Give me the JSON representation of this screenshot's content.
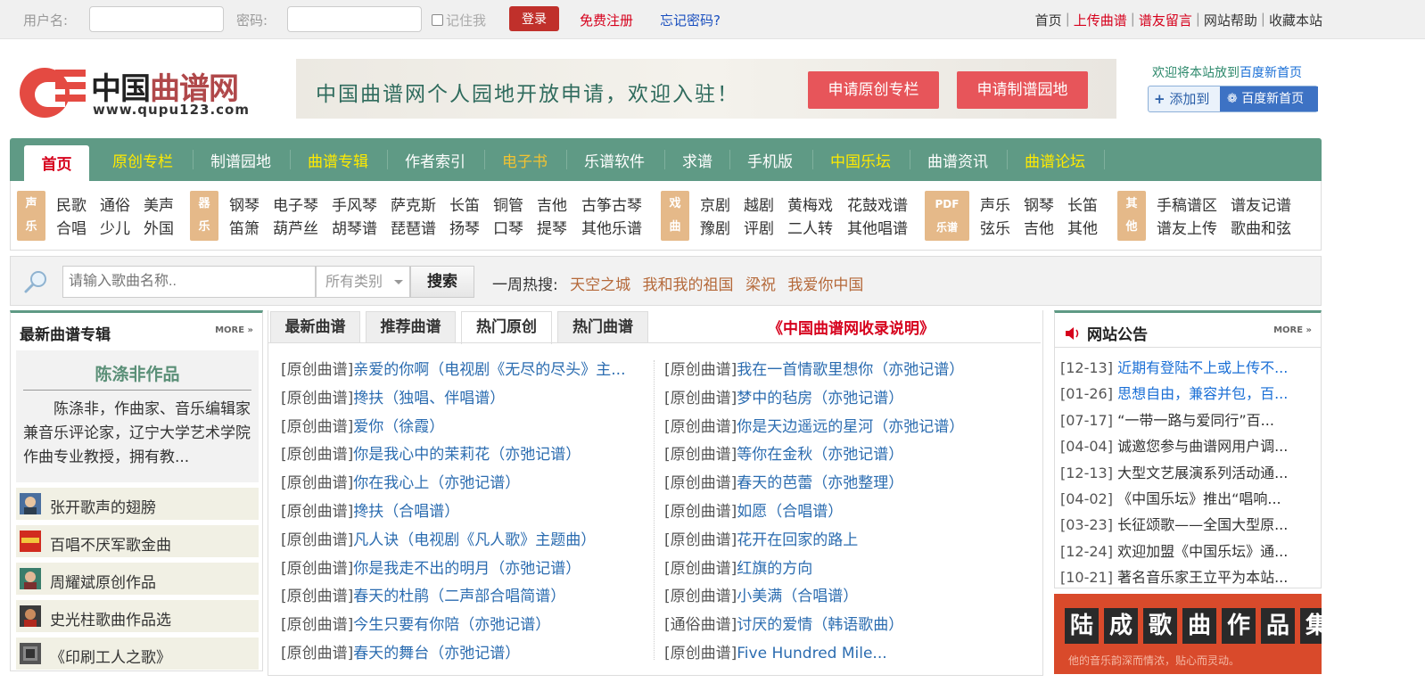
{
  "topbar": {
    "username_label": "用户名:",
    "password_label": "密码:",
    "remember_label": "记住我",
    "login_label": "登录",
    "register_label": "免费注册",
    "forgot_label": "忘记密码?",
    "links": [
      "首页",
      "上传曲谱",
      "谱友留言",
      "网站帮助",
      "收藏本站"
    ]
  },
  "logo": {
    "cn_black": "中国",
    "cn_red": "曲谱网",
    "domain": "www.qupu123.com"
  },
  "banner": {
    "text": "中国曲谱网个人园地开放申请，欢迎入驻！",
    "btn1": "申请原创专栏",
    "btn2": "申请制谱园地"
  },
  "welcome": {
    "text": "欢迎将本站放到",
    "highlight": "百度新首页",
    "add_label": "添加到",
    "baidu_label": "百度新首页"
  },
  "nav": {
    "home": "首页",
    "items": [
      "原创专栏",
      "制谱园地",
      "曲谱专辑",
      "作者索引",
      "电子书",
      "乐谱软件",
      "求谱",
      "手机版",
      "中国乐坛",
      "曲谱资讯",
      "曲谱论坛"
    ],
    "colors": {
      "white": "#ffffff",
      "yellow": "#ffea00",
      "bar": "#5f9a85"
    }
  },
  "categories": {
    "vocal_badge": [
      "声",
      "乐"
    ],
    "vocal_row1": [
      "民歌",
      "通俗",
      "美声"
    ],
    "vocal_row2": [
      "合唱",
      "少儿",
      "外国"
    ],
    "instr_badge": [
      "器",
      "乐"
    ],
    "instr_row1": [
      "钢琴",
      "电子琴",
      "手风琴",
      "萨克斯",
      "长笛",
      "铜管",
      "吉他",
      "古筝古琴"
    ],
    "instr_row2": [
      "笛箫",
      "葫芦丝",
      "胡琴谱",
      "琵琶谱",
      "扬琴",
      "口琴",
      "提琴",
      "其他乐谱"
    ],
    "opera_badge": [
      "戏",
      "曲"
    ],
    "opera_row1": [
      "京剧",
      "越剧",
      "黄梅戏",
      "花鼓戏谱"
    ],
    "opera_row2": [
      "豫剧",
      "评剧",
      "二人转",
      "其他唱谱"
    ],
    "pdf_badge": [
      "PDF",
      "乐谱"
    ],
    "pdf_row1": [
      "声乐",
      "钢琴",
      "长笛"
    ],
    "pdf_row2": [
      "弦乐",
      "吉他",
      "其他"
    ],
    "other_badge": [
      "其",
      "他"
    ],
    "other_row1": [
      "手稿谱区",
      "谱友记谱"
    ],
    "other_row2": [
      "谱友上传",
      "歌曲和弦"
    ]
  },
  "search": {
    "placeholder": "请输入歌曲名称..",
    "category_selected": "所有类别",
    "button": "搜索",
    "hot_label": "一周热搜:",
    "hot_items": [
      "天空之城",
      "我和我的祖国",
      "梁祝",
      "我爱你中国"
    ]
  },
  "left": {
    "title": "最新曲谱专辑",
    "more": "MORE »",
    "featured_title": "陈涤非作品",
    "featured_desc": "陈涤非，作曲家、音乐编辑家兼音乐评论家，辽宁大学艺术学院作曲专业教授，拥有教...",
    "albums": [
      "张开歌声的翅膀",
      "百唱不厌军歌金曲",
      "周耀斌原创作品",
      "史光柱歌曲作品选",
      "《印刷工人之歌》"
    ]
  },
  "middle": {
    "tabs": [
      "最新曲谱",
      "推荐曲谱",
      "热门原创",
      "热门曲谱"
    ],
    "active_tab": "热门原创",
    "notice": "《中国曲谱网收录说明》",
    "col1": [
      {
        "cat": "[原创曲谱]",
        "name": "亲爱的你啊（电视剧《无尽的尽头》主..."
      },
      {
        "cat": "[原创曲谱]",
        "name": "搀扶（独唱、伴唱谱）"
      },
      {
        "cat": "[原创曲谱]",
        "name": "爱你（徐霞）"
      },
      {
        "cat": "[原创曲谱]",
        "name": "你是我心中的茉莉花（亦弛记谱）"
      },
      {
        "cat": "[原创曲谱]",
        "name": "你在我心上（亦弛记谱）"
      },
      {
        "cat": "[原创曲谱]",
        "name": "搀扶（合唱谱）"
      },
      {
        "cat": "[原创曲谱]",
        "name": "凡人诀（电视剧《凡人歌》主题曲）"
      },
      {
        "cat": "[原创曲谱]",
        "name": "你是我走不出的明月（亦弛记谱）"
      },
      {
        "cat": "[原创曲谱]",
        "name": "春天的杜鹃（二声部合唱简谱）"
      },
      {
        "cat": "[原创曲谱]",
        "name": "今生只要有你陪（亦弛记谱）"
      },
      {
        "cat": "[原创曲谱]",
        "name": "春天的舞台（亦弛记谱）"
      }
    ],
    "col2": [
      {
        "cat": "[原创曲谱]",
        "name": "我在一首情歌里想你（亦弛记谱）"
      },
      {
        "cat": "[原创曲谱]",
        "name": "梦中的毡房（亦弛记谱）"
      },
      {
        "cat": "[原创曲谱]",
        "name": "你是天边遥远的星河（亦弛记谱）"
      },
      {
        "cat": "[原创曲谱]",
        "name": "等你在金秋（亦弛记谱）"
      },
      {
        "cat": "[原创曲谱]",
        "name": "春天的芭蕾（亦弛整理）"
      },
      {
        "cat": "[原创曲谱]",
        "name": "如愿（合唱谱）"
      },
      {
        "cat": "[原创曲谱]",
        "name": "花开在回家的路上"
      },
      {
        "cat": "[原创曲谱]",
        "name": "红旗的方向"
      },
      {
        "cat": "[原创曲谱]",
        "name": "小美满（合唱谱）"
      },
      {
        "cat": "[通俗曲谱]",
        "name": "讨厌的爱情（韩语歌曲）"
      },
      {
        "cat": "[原创曲谱]",
        "name": "Five Hundred Mile..."
      }
    ]
  },
  "right": {
    "title": "网站公告",
    "more": "MORE »",
    "news": [
      {
        "date": "[12-13]",
        "title": "近期有登陆不上或上传不...",
        "highlight": true
      },
      {
        "date": "[01-26]",
        "title": "思想自由，兼容并包，百...",
        "highlight": true
      },
      {
        "date": "[07-17]",
        "title": "“一带一路与爱同行”百...",
        "highlight": false
      },
      {
        "date": "[04-04]",
        "title": "诚邀您参与曲谱网用户调...",
        "highlight": false
      },
      {
        "date": "[12-13]",
        "title": "大型文艺展演系列活动通...",
        "highlight": false
      },
      {
        "date": "[04-02]",
        "title": "《中国乐坛》推出“唱响...",
        "highlight": false
      },
      {
        "date": "[03-23]",
        "title": "长征颂歌——全国大型原...",
        "highlight": false
      },
      {
        "date": "[12-24]",
        "title": "欢迎加盟《中国乐坛》通...",
        "highlight": false
      },
      {
        "date": "[10-21]",
        "title": "著名音乐家王立平为本站...",
        "highlight": false
      }
    ],
    "ad_chars": [
      "陆",
      "成",
      "歌",
      "曲",
      "作",
      "品",
      "集"
    ],
    "ad_sub": "他的音乐韵深而情浓，贴心而灵动。"
  }
}
